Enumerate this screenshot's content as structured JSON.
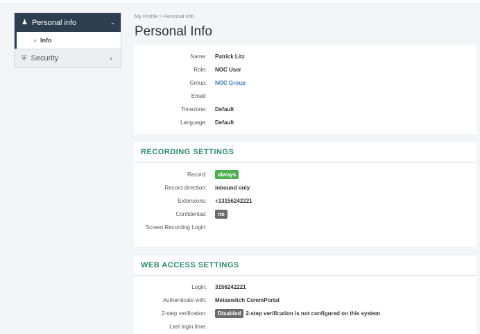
{
  "sidebar": {
    "header": "Personal info",
    "sub_item": "Info",
    "security": "Security"
  },
  "breadcrumb": {
    "root": "My Profile",
    "sep": ">",
    "current": "Personal info"
  },
  "page_title": "Personal Info",
  "personal": [
    {
      "k": "Name:",
      "v": "Patrick Litz"
    },
    {
      "k": "Role:",
      "v": "NOC User"
    },
    {
      "k": "Group:",
      "v": "NOC Group"
    },
    {
      "k": "Email:",
      "v": ""
    },
    {
      "k": "Timezone:",
      "v": "Default"
    },
    {
      "k": "Language:",
      "v": "Default"
    }
  ],
  "recording": {
    "title": "RECORDING SETTINGS",
    "record_label": "Record:",
    "record_value": "always",
    "direction_label": "Record direction:",
    "direction_value": "inbound only",
    "ext_label": "Extensions:",
    "ext_value": "+13156242221",
    "conf_label": "Confidential:",
    "conf_value": "no",
    "screen_label": "Screen Recording Login:"
  },
  "web": {
    "title": "WEB ACCESS SETTINGS",
    "login_label": "Login:",
    "login_value": "3156242221",
    "auth_label": "Authenticate with:",
    "auth_value": "Metaswitch CommPortal",
    "twostep_label": "2-step verification:",
    "twostep_badge": "Disabled",
    "twostep_text": "2-step verification is not configured on this system",
    "last_label": "Last login time:"
  },
  "colors": {
    "sidebar_header": "#2c3e50",
    "section_title": "#2a8a6e",
    "badge_green": "#4cae4c",
    "badge_gray": "#6b6b6b",
    "link": "#3a7ab8"
  }
}
